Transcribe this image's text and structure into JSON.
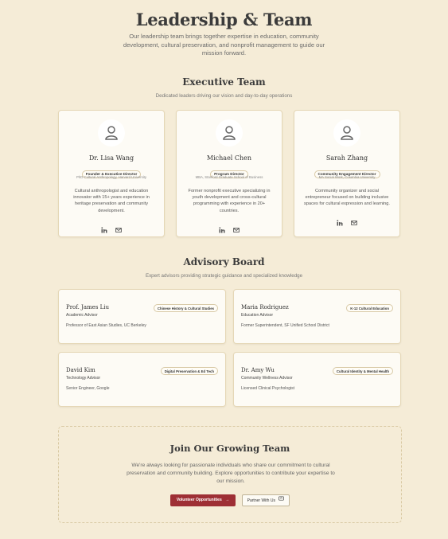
{
  "header": {
    "title": "Leadership & Team",
    "subtitle": "Our leadership team brings together expertise in education, community development, cultural preservation, and nonprofit management to guide our mission forward."
  },
  "executive": {
    "title": "Executive Team",
    "subtitle": "Dedicated leaders driving our vision and day-to-day operations",
    "members": [
      {
        "name": "Dr. Lisa Wang",
        "role": "Founder & Executive Director",
        "education": "PhD Cultural Anthropology, Harvard University",
        "bio": "Cultural anthropologist and education innovator with 15+ years experience in heritage preservation and community development.",
        "icons": [
          "linkedin-icon",
          "email-icon"
        ]
      },
      {
        "name": "Michael Chen",
        "role": "Program Director",
        "education": "MBA, Stanford Graduate School of Business",
        "bio": "Former nonprofit executive specializing in youth development and cross-cultural programming with experience in 20+ countries.",
        "icons": [
          "linkedin-icon",
          "email-icon"
        ]
      },
      {
        "name": "Sarah Zhang",
        "role": "Community Engagement Director",
        "education": "MA Social Work, Columbia University",
        "bio": "Community organizer and social entrepreneur focused on building inclusive spaces for cultural expression and learning.",
        "icons": [
          "linkedin-icon",
          "email-icon"
        ]
      }
    ]
  },
  "advisory": {
    "title": "Advisory Board",
    "subtitle": "Expert advisors providing strategic guidance and specialized knowledge",
    "members": [
      {
        "name": "Prof. James Liu",
        "role": "Academic Advisor",
        "detail": "Professor of East Asian Studies, UC Berkeley",
        "badge": "Chinese History & Cultural Studies"
      },
      {
        "name": "Maria Rodriguez",
        "role": "Education Advisor",
        "detail": "Former Superintendent, SF Unified School District",
        "badge": "K-12 Cultural Education"
      },
      {
        "name": "David Kim",
        "role": "Technology Advisor",
        "detail": "Senior Engineer, Google",
        "badge": "Digital Preservation & Ed Tech"
      },
      {
        "name": "Dr. Amy Wu",
        "role": "Community Wellness Advisor",
        "detail": "Licensed Clinical Psychologist",
        "badge": "Cultural Identity & Mental Health"
      }
    ]
  },
  "join": {
    "title": "Join Our Growing Team",
    "text": "We're always looking for passionate individuals who share our commitment to cultural preservation and community building. Explore opportunities to contribute your expertise to our mission.",
    "primary_button": "Volunteer Opportunities",
    "secondary_button": "Partner With Us"
  },
  "colors": {
    "background": "#f5ecd7",
    "card": "#fdfbf5",
    "border": "#e5d7b6",
    "accent": "#9e2f35"
  }
}
